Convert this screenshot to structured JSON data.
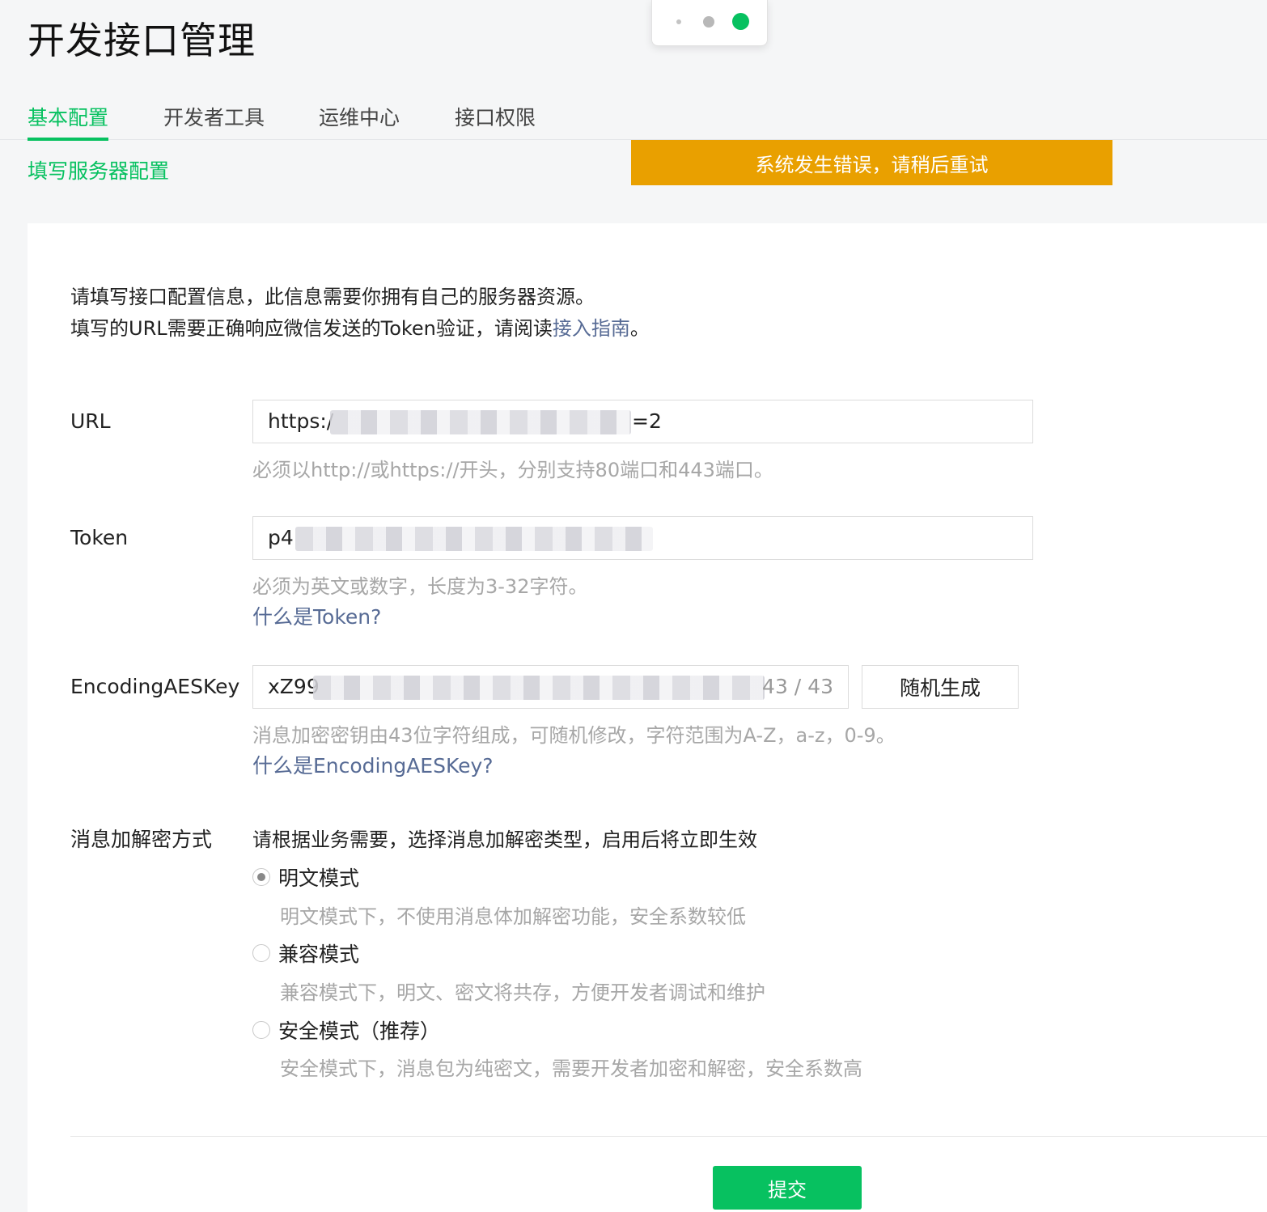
{
  "page": {
    "title": "开发接口管理"
  },
  "tabs": [
    {
      "label": "基本配置",
      "active": true
    },
    {
      "label": "开发者工具",
      "active": false
    },
    {
      "label": "运维中心",
      "active": false
    },
    {
      "label": "接口权限",
      "active": false
    }
  ],
  "subtitle": "填写服务器配置",
  "error_banner": "系统发生错误，请稍后重试",
  "intro": {
    "line1": "请填写接口配置信息，此信息需要你拥有自己的服务器资源。",
    "line2_prefix": "填写的URL需要正确响应微信发送的Token验证，请阅读",
    "line2_link": "接入指南",
    "line2_suffix": "。"
  },
  "url": {
    "label": "URL",
    "value_start": "https:/",
    "value_end": "=2",
    "hint": "必须以http://或https://开头，分别支持80端口和443端口。"
  },
  "token": {
    "label": "Token",
    "value_start": "p4",
    "hint": "必须为英文或数字，长度为3-32字符。",
    "help": "什么是Token?"
  },
  "aes": {
    "label": "EncodingAESKey",
    "value_start": "xZ99",
    "counter": "43 / 43",
    "random_button": "随机生成",
    "hint": "消息加密密钥由43位字符组成，可随机修改，字符范围为A-Z，a-z，0-9。",
    "help": "什么是EncodingAESKey?"
  },
  "encryption": {
    "label": "消息加解密方式",
    "desc": "请根据业务需要，选择消息加解密类型，启用后将立即生效",
    "options": [
      {
        "label": "明文模式",
        "desc": "明文模式下，不使用消息体加解密功能，安全系数较低",
        "checked": true
      },
      {
        "label": "兼容模式",
        "desc": "兼容模式下，明文、密文将共存，方便开发者调试和维护",
        "checked": false
      },
      {
        "label": "安全模式（推荐）",
        "desc": "安全模式下，消息包为纯密文，需要开发者加密和解密，安全系数高",
        "checked": false
      }
    ]
  },
  "submit": "提交",
  "colors": {
    "brand": "#07c160",
    "warning": "#e9a000",
    "link": "#576b95"
  }
}
